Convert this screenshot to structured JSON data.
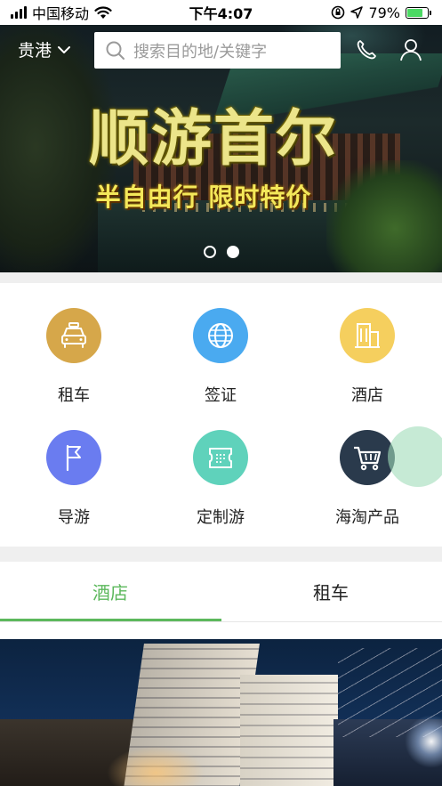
{
  "status_bar": {
    "carrier": "中国移动",
    "time": "下午4:07",
    "battery_percent": "79%",
    "battery_level": 0.79,
    "icons": [
      "signal-icon",
      "wifi-icon",
      "orientation-lock-icon",
      "location-arrow-icon",
      "battery-charging-icon"
    ]
  },
  "header": {
    "city": "贵港",
    "search_placeholder": "搜索目的地/关键字",
    "icons": [
      "chevron-down-icon",
      "search-icon",
      "phone-icon",
      "user-icon"
    ]
  },
  "banner": {
    "headline": "顺游首尔",
    "subline": "半自由行  限时特价",
    "slides_total": 2,
    "active_slide": 2
  },
  "categories": [
    {
      "label": "租车",
      "icon": "car-icon",
      "color": "#d6a74a"
    },
    {
      "label": "签证",
      "icon": "globe-icon",
      "color": "#4aaaf0"
    },
    {
      "label": "酒店",
      "icon": "building-icon",
      "color": "#f5cf5e"
    },
    {
      "label": "导游",
      "icon": "flag-icon",
      "color": "#6a7cf0"
    },
    {
      "label": "定制游",
      "icon": "ticket-icon",
      "color": "#5fd2bb"
    },
    {
      "label": "海淘产品",
      "icon": "cart-icon",
      "color": "#2a3a4c"
    }
  ],
  "tabs": [
    {
      "label": "酒店",
      "active": true
    },
    {
      "label": "租车",
      "active": false
    }
  ],
  "colors": {
    "accent_green": "#5cb85c",
    "divider": "#efefef"
  }
}
